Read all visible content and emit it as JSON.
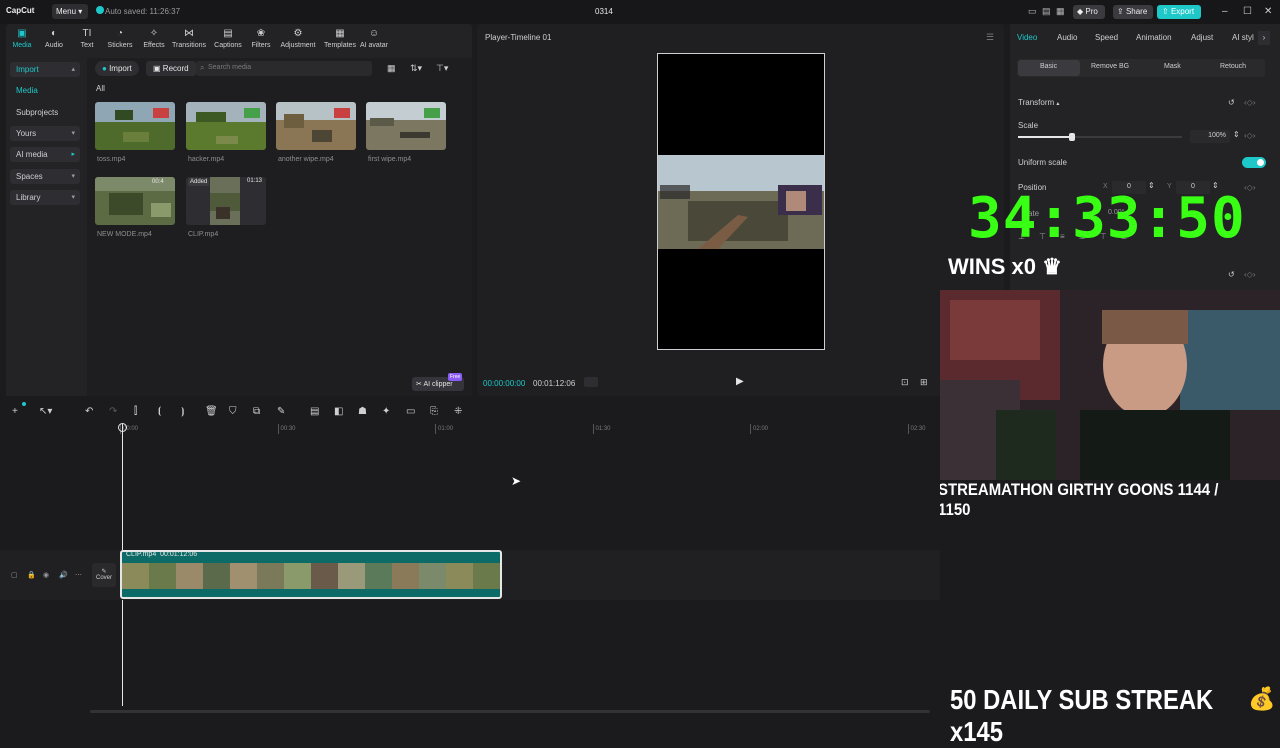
{
  "titlebar": {
    "app_name": "CapCut",
    "menu_label": "Menu",
    "autosave_text": "Auto saved: 11:26:37",
    "project_name": "0314",
    "pro_label": "Pro",
    "share_label": "Share",
    "export_label": "Export"
  },
  "toolbar": {
    "items": [
      {
        "label": "Media",
        "icon": "media-icon"
      },
      {
        "label": "Audio",
        "icon": "audio-icon"
      },
      {
        "label": "Text",
        "icon": "text-icon"
      },
      {
        "label": "Stickers",
        "icon": "stickers-icon"
      },
      {
        "label": "Effects",
        "icon": "effects-icon"
      },
      {
        "label": "Transitions",
        "icon": "transitions-icon"
      },
      {
        "label": "Captions",
        "icon": "captions-icon"
      },
      {
        "label": "Filters",
        "icon": "filters-icon"
      },
      {
        "label": "Adjustment",
        "icon": "adjustment-icon"
      },
      {
        "label": "Templates",
        "icon": "templates-icon"
      },
      {
        "label": "AI avatar",
        "icon": "ai-avatar-icon"
      }
    ]
  },
  "sidebar": {
    "items": [
      "Import",
      "Media",
      "Subprojects",
      "Yours",
      "AI media",
      "Spaces",
      "Library"
    ]
  },
  "media": {
    "import_label": "Import",
    "record_label": "Record",
    "search_placeholder": "Search media",
    "filter_label": "All",
    "items": [
      {
        "name": "toss.mp4"
      },
      {
        "name": "hacker.mp4"
      },
      {
        "name": "another wipe.mp4"
      },
      {
        "name": "first wipe.mp4"
      },
      {
        "name": "NEW MODE.mp4",
        "duration": "00:4"
      },
      {
        "name": "CLIP.mp4",
        "badge": "Added",
        "duration": "01:13"
      }
    ],
    "ai_clipper_label": "AI clipper",
    "free_tag": "Free"
  },
  "player": {
    "title": "Player-Timeline 01",
    "current_time": "00:00:00:00",
    "total_time": "00:01:12:06"
  },
  "right_panel": {
    "tabs": [
      "Video",
      "Audio",
      "Speed",
      "Animation",
      "Adjust",
      "AI styl"
    ],
    "subtabs": [
      "Basic",
      "Remove BG",
      "Mask",
      "Retouch"
    ],
    "section_title": "Transform",
    "scale_label": "Scale",
    "scale_value": "100%",
    "scale_level": 0.33,
    "uniform_scale_label": "Uniform scale",
    "position_label": "Position",
    "pos_x_label": "X",
    "pos_x": "0",
    "pos_y_label": "Y",
    "pos_y": "0",
    "rotate_partial": "ate",
    "rotate_value": "0.00°"
  },
  "overlay": {
    "timer": "34:33:50",
    "wins": "WINS x0",
    "streamathon": "STREAMATHON GIRTHY GOONS  1144 / 1150",
    "sub_streak": "50 DAILY SUB STREAK  x145"
  },
  "timeline": {
    "ruler": [
      "00:00",
      "00:30",
      "01:00",
      "01:30",
      "02:00",
      "02:30"
    ],
    "clip_name": "CLIP.mp4",
    "clip_duration": "00:01:12:06",
    "cover_label": "Cover"
  },
  "colors": {
    "accent": "#1ec8c8",
    "timer_green": "#39ff14",
    "clip_teal": "#0d6b67"
  }
}
